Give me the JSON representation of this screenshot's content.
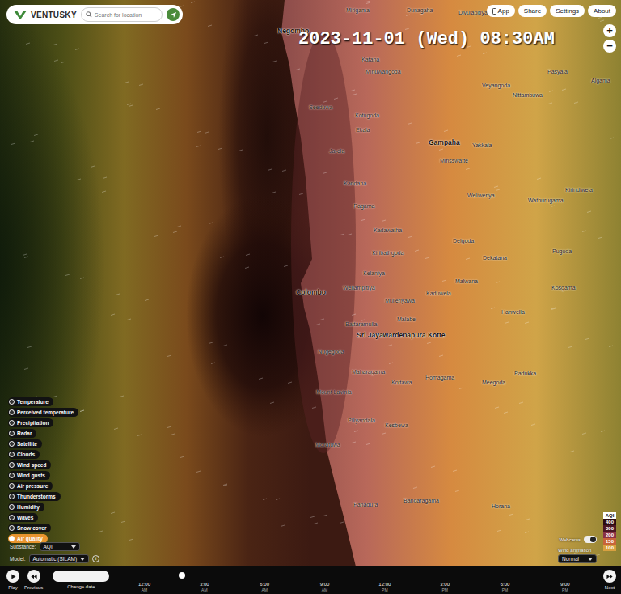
{
  "logo": {
    "text": "VENTUSKY"
  },
  "search": {
    "placeholder": "Search for location"
  },
  "top_buttons": [
    {
      "label": "App",
      "kind": "app"
    },
    {
      "label": "Share",
      "kind": "plain"
    },
    {
      "label": "Settings",
      "kind": "plain"
    },
    {
      "label": "About",
      "kind": "plain"
    }
  ],
  "zoom": [
    "+",
    "−"
  ],
  "timestamp": "2023-11-01 (Wed) 08:30AM",
  "places": [
    {
      "name": "Negombo",
      "major": true
    },
    {
      "name": "Mirigama",
      "major": false
    },
    {
      "name": "Dunagaha",
      "major": false
    },
    {
      "name": "Divulapitiya",
      "major": false
    },
    {
      "name": "Katana",
      "major": false
    },
    {
      "name": "Minuwangoda",
      "major": false
    },
    {
      "name": "Veyangoda",
      "major": false
    },
    {
      "name": "Nittambuwa",
      "major": false
    },
    {
      "name": "Pasyala",
      "major": false
    },
    {
      "name": "Algama",
      "major": false
    },
    {
      "name": "Seeduwa",
      "major": false
    },
    {
      "name": "Kotugoda",
      "major": false
    },
    {
      "name": "Ekala",
      "major": false
    },
    {
      "name": "Ja-ela",
      "major": false
    },
    {
      "name": "Gampaha",
      "major": true
    },
    {
      "name": "Yakkala",
      "major": false
    },
    {
      "name": "Mirisswatte",
      "major": false
    },
    {
      "name": "Kandana",
      "major": false
    },
    {
      "name": "Ragama",
      "major": false
    },
    {
      "name": "Weliweriya",
      "major": false
    },
    {
      "name": "Wathurugama",
      "major": false
    },
    {
      "name": "Kirindiwela",
      "major": false
    },
    {
      "name": "Kadawatha",
      "major": false
    },
    {
      "name": "Delgoda",
      "major": false
    },
    {
      "name": "Kiribathgoda",
      "major": false
    },
    {
      "name": "Dekatana",
      "major": false
    },
    {
      "name": "Pugoda",
      "major": false
    },
    {
      "name": "Kelaniya",
      "major": false
    },
    {
      "name": "Malwana",
      "major": false
    },
    {
      "name": "Kosgama",
      "major": false
    },
    {
      "name": "Wellampitiya",
      "major": false
    },
    {
      "name": "Colombo",
      "major": true
    },
    {
      "name": "Kaduwela",
      "major": false
    },
    {
      "name": "Mulleriyawa",
      "major": false
    },
    {
      "name": "Hanwella",
      "major": false
    },
    {
      "name": "Malabe",
      "major": false
    },
    {
      "name": "Battaramulla",
      "major": false
    },
    {
      "name": "Sri Jayawardenapura Kotte",
      "major": true
    },
    {
      "name": "Nugegoda",
      "major": false
    },
    {
      "name": "Maharagama",
      "major": false
    },
    {
      "name": "Homagama",
      "major": false
    },
    {
      "name": "Padukka",
      "major": false
    },
    {
      "name": "Meegoda",
      "major": false
    },
    {
      "name": "Kottawa",
      "major": false
    },
    {
      "name": "Mount Lavinia",
      "major": false
    },
    {
      "name": "Piliyandala",
      "major": false
    },
    {
      "name": "Kesbewa",
      "major": false
    },
    {
      "name": "Moratuwa",
      "major": false
    },
    {
      "name": "Panadura",
      "major": false
    },
    {
      "name": "Bandaragama",
      "major": false
    },
    {
      "name": "Horana",
      "major": false
    }
  ],
  "layers": [
    {
      "label": "Temperature",
      "selected": false
    },
    {
      "label": "Perceived temperature",
      "selected": false
    },
    {
      "label": "Precipitation",
      "selected": false
    },
    {
      "label": "Radar",
      "selected": false
    },
    {
      "label": "Satellite",
      "selected": false
    },
    {
      "label": "Clouds",
      "selected": false
    },
    {
      "label": "Wind speed",
      "selected": false
    },
    {
      "label": "Wind gusts",
      "selected": false
    },
    {
      "label": "Air pressure",
      "selected": false
    },
    {
      "label": "Thunderstorms",
      "selected": false
    },
    {
      "label": "Humidity",
      "selected": false
    },
    {
      "label": "Waves",
      "selected": false
    },
    {
      "label": "Snow cover",
      "selected": false
    },
    {
      "label": "Air quality",
      "selected": true
    }
  ],
  "substance": {
    "label": "Substance:",
    "value": "AQI"
  },
  "model": {
    "label": "Model:",
    "value": "Automatic (SILAM)",
    "info": "i"
  },
  "legend": {
    "title": "AQI",
    "steps": [
      {
        "value": "400",
        "color": "#2a0c12"
      },
      {
        "value": "300",
        "color": "#4a1622"
      },
      {
        "value": "200",
        "color": "#8a3246"
      },
      {
        "value": "150",
        "color": "#c8643a"
      },
      {
        "value": "100",
        "color": "#d8a040"
      }
    ]
  },
  "webcams": {
    "label": "Webcams",
    "on": true
  },
  "wind_animation": {
    "label": "Wind animation",
    "value": "Normal"
  },
  "timeline": {
    "play": "Play",
    "previous": "Previous",
    "change_date": "Change date",
    "next": "Next",
    "level": 0.14,
    "ticks": [
      {
        "time": "12:00",
        "period": "AM"
      },
      {
        "time": "3:00",
        "period": "AM"
      },
      {
        "time": "6:00",
        "period": "AM"
      },
      {
        "time": "9:00",
        "period": "AM"
      },
      {
        "time": "12:00",
        "period": "PM"
      },
      {
        "time": "3:00",
        "period": "PM"
      },
      {
        "time": "6:00",
        "period": "PM"
      },
      {
        "time": "9:00",
        "period": "PM"
      }
    ]
  }
}
